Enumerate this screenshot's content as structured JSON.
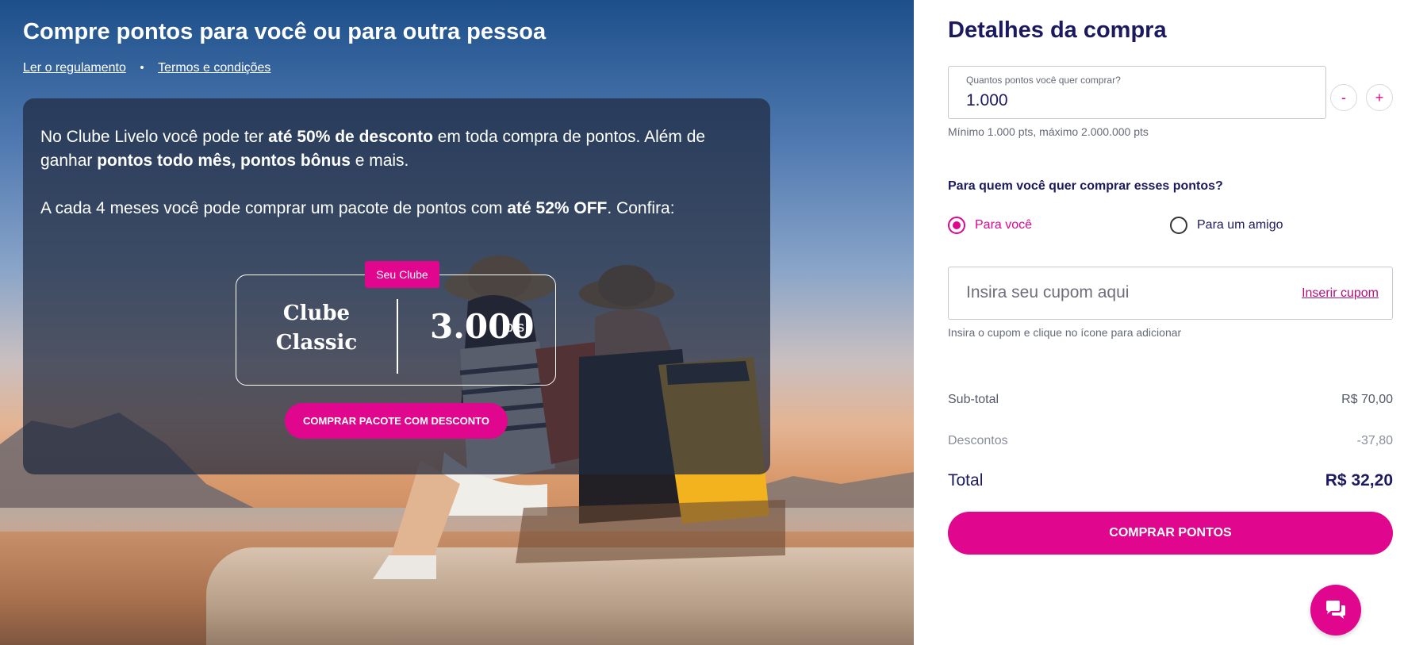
{
  "hero": {
    "title": "Compre pontos para você ou para outra pessoa",
    "links": {
      "rules": "Ler o regulamento",
      "separator": "•",
      "terms": "Termos e condições"
    },
    "info": {
      "p1_a": "No Clube Livelo você pode ter ",
      "p1_b": "até 50% de desconto",
      "p1_c": " em toda compra de pontos. Além de ganhar ",
      "p1_d": "pontos todo mês, pontos bônus",
      "p1_e": " e mais.",
      "p2_a": "A cada 4 meses você pode comprar um pacote de pontos com ",
      "p2_b": "até 52% OFF",
      "p2_c": ". Confira:"
    },
    "package": {
      "tag": "Seu Clube",
      "name_line1": "Clube",
      "name_line2": "Classic",
      "points": "3.000",
      "points_unit": "pts",
      "button": "COMPRAR PACOTE COM DESCONTO"
    }
  },
  "panel": {
    "title": "Detalhes da compra",
    "quantity": {
      "label": "Quantos pontos você quer comprar?",
      "value": "1.000",
      "minus": "-",
      "plus": "+",
      "hint": "Mínimo 1.000 pts, máximo 2.000.000 pts"
    },
    "recipient": {
      "question": "Para quem você quer comprar esses pontos?",
      "option_self": "Para você",
      "option_friend": "Para um amigo",
      "selected": "self"
    },
    "coupon": {
      "placeholder": "Insira seu cupom aqui",
      "link": "Inserir cupom",
      "hint": "Insira o cupom e clique no ícone para adicionar"
    },
    "summary": {
      "subtotal_label": "Sub-total",
      "subtotal_value": "R$ 70,00",
      "discount_label": "Descontos",
      "discount_value": "-37,80",
      "total_label": "Total",
      "total_value": "R$ 32,20"
    },
    "buy_button": "COMPRAR PONTOS",
    "chat_icon": "chat-bubbles-icon"
  },
  "colors": {
    "accent": "#e0068d",
    "navy": "#1c1a5e",
    "link": "#b2127a"
  }
}
